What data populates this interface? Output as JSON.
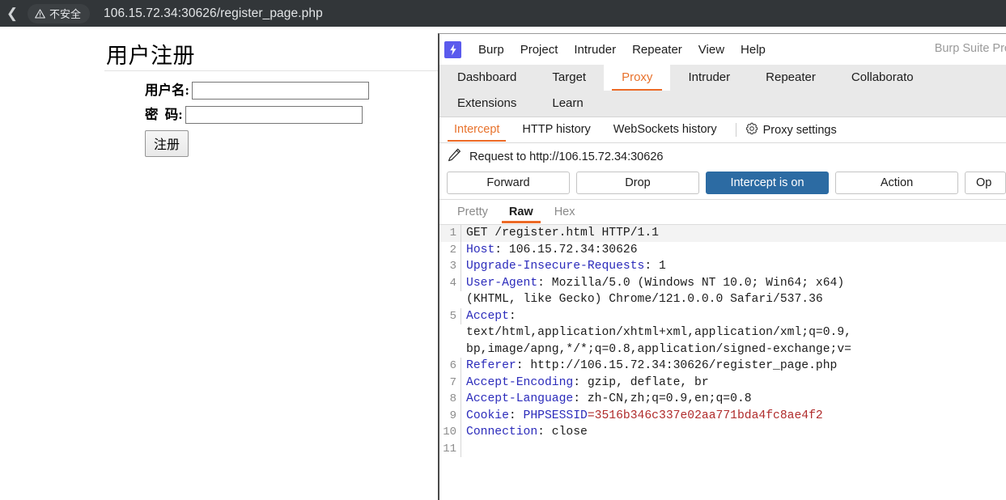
{
  "browser": {
    "back_icon": "back-chevron-icon",
    "security_icon": "warning-triangle-icon",
    "security_label": "不安全",
    "url": "106.15.72.34:30626/register_page.php"
  },
  "web_page": {
    "title": "用户注册",
    "fields": [
      {
        "label": "用户名:",
        "value": "",
        "name": "username"
      },
      {
        "label": "密  码:",
        "value": "",
        "name": "password"
      }
    ],
    "submit_label": "注册"
  },
  "burp": {
    "logo_icon": "burp-lightning-icon",
    "product_name": "Burp Suite Pro",
    "menu": [
      "Burp",
      "Project",
      "Intruder",
      "Repeater",
      "View",
      "Help"
    ],
    "tabs": [
      {
        "label": "Dashboard",
        "active": false
      },
      {
        "label": "Target",
        "active": false
      },
      {
        "label": "Proxy",
        "active": true
      },
      {
        "label": "Intruder",
        "active": false
      },
      {
        "label": "Repeater",
        "active": false
      },
      {
        "label": "Collaborato",
        "active": false
      },
      {
        "label": "Extensions",
        "active": false
      },
      {
        "label": "Learn",
        "active": false
      }
    ],
    "proxy_subtabs": [
      {
        "label": "Intercept",
        "active": true
      },
      {
        "label": "HTTP history",
        "active": false
      },
      {
        "label": "WebSockets history",
        "active": false
      }
    ],
    "proxy_settings": {
      "icon": "gear-icon",
      "label": "Proxy settings"
    },
    "request_bar": {
      "icon": "pencil-icon",
      "text": "Request to http://106.15.72.34:30626"
    },
    "actions": [
      {
        "label": "Forward",
        "primary": false
      },
      {
        "label": "Drop",
        "primary": false
      },
      {
        "label": "Intercept is on",
        "primary": true
      },
      {
        "label": "Action",
        "primary": false
      },
      {
        "label": "Op",
        "primary": false
      }
    ],
    "view_tabs": [
      {
        "label": "Pretty",
        "active": false
      },
      {
        "label": "Raw",
        "active": true
      },
      {
        "label": "Hex",
        "active": false
      }
    ],
    "request_lines": [
      {
        "n": "1",
        "highlight": true,
        "parts": [
          {
            "t": "GET /register.html HTTP/1.1",
            "c": "plain"
          }
        ]
      },
      {
        "n": "2",
        "highlight": false,
        "parts": [
          {
            "t": "Host",
            "c": "hdr"
          },
          {
            "t": ": 106.15.72.34:30626",
            "c": "plain"
          }
        ]
      },
      {
        "n": "3",
        "highlight": false,
        "parts": [
          {
            "t": "Upgrade-Insecure-Requests",
            "c": "hdr"
          },
          {
            "t": ": 1",
            "c": "plain"
          }
        ]
      },
      {
        "n": "4",
        "highlight": false,
        "parts": [
          {
            "t": "User-Agent",
            "c": "hdr"
          },
          {
            "t": ": Mozilla/5.0 (Windows NT 10.0; Win64; x64)",
            "c": "plain"
          }
        ]
      },
      {
        "n": "",
        "highlight": false,
        "parts": [
          {
            "t": "(KHTML, like Gecko) Chrome/121.0.0.0 Safari/537.36",
            "c": "plain"
          }
        ]
      },
      {
        "n": "5",
        "highlight": false,
        "parts": [
          {
            "t": "Accept",
            "c": "hdr"
          },
          {
            "t": ":",
            "c": "plain"
          }
        ]
      },
      {
        "n": "",
        "highlight": false,
        "parts": [
          {
            "t": "text/html,application/xhtml+xml,application/xml;q=0.9,",
            "c": "plain"
          }
        ]
      },
      {
        "n": "",
        "highlight": false,
        "parts": [
          {
            "t": "bp,image/apng,*/*;q=0.8,application/signed-exchange;v=",
            "c": "plain"
          }
        ]
      },
      {
        "n": "6",
        "highlight": false,
        "parts": [
          {
            "t": "Referer",
            "c": "hdr"
          },
          {
            "t": ": http://106.15.72.34:30626/register_page.php",
            "c": "plain"
          }
        ]
      },
      {
        "n": "7",
        "highlight": false,
        "parts": [
          {
            "t": "Accept-Encoding",
            "c": "hdr"
          },
          {
            "t": ": gzip, deflate, br",
            "c": "plain"
          }
        ]
      },
      {
        "n": "8",
        "highlight": false,
        "parts": [
          {
            "t": "Accept-Language",
            "c": "hdr"
          },
          {
            "t": ": zh-CN,zh;q=0.9,en;q=0.8",
            "c": "plain"
          }
        ]
      },
      {
        "n": "9",
        "highlight": false,
        "parts": [
          {
            "t": "Cookie",
            "c": "hdr"
          },
          {
            "t": ": ",
            "c": "plain"
          },
          {
            "t": "PHPSESSID",
            "c": "hdr"
          },
          {
            "t": "=3516b346c337e02aa771bda4fc8ae4f2",
            "c": "ckv"
          }
        ]
      },
      {
        "n": "10",
        "highlight": false,
        "parts": [
          {
            "t": "Connection",
            "c": "hdr"
          },
          {
            "t": ": close",
            "c": "plain"
          }
        ]
      },
      {
        "n": "11",
        "highlight": false,
        "parts": [
          {
            "t": "",
            "c": "plain"
          }
        ]
      }
    ]
  },
  "colors": {
    "accent_orange": "#ec6a26",
    "primary_blue": "#2c6ba3",
    "burp_logo": "#5a5aed",
    "header_blue": "#2b2bbb",
    "cookie_red": "#b02b2b",
    "chrome_dark": "#323639"
  }
}
